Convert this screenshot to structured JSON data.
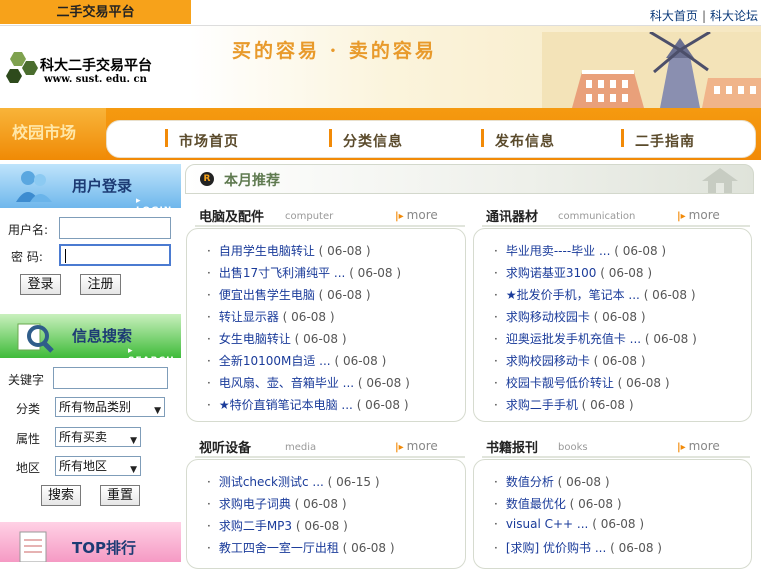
{
  "header": {
    "site_tab": "二手交易平台",
    "links": [
      "科大首页",
      "科大论坛"
    ]
  },
  "banner": {
    "logo_title": "科大二手交易平台",
    "logo_url": "www. sust. edu. cn",
    "slogan": "买的容易 · 卖的容易"
  },
  "nav": {
    "campus": "校园市场",
    "items": [
      "市场首页",
      "分类信息",
      "发布信息",
      "二手指南"
    ]
  },
  "login": {
    "title": "用户登录",
    "subtitle": "▸ LOGIN",
    "username_label": "用户名:",
    "password_label": "密  码:",
    "login_button": "登录",
    "register_button": "注册"
  },
  "search": {
    "title": "信息搜索",
    "subtitle": "▸ SEARCH",
    "keyword_label": "关键字",
    "category_label": "分类",
    "category_value": "所有物品类别",
    "type_label": "属性",
    "type_value": "所有买卖",
    "region_label": "地区",
    "region_value": "所有地区",
    "search_button": "搜索",
    "reset_button": "重置"
  },
  "top": {
    "title": "TOP排行"
  },
  "recommend": {
    "badge": "R",
    "title": "本月推荐"
  },
  "more_label": "more",
  "sections": [
    {
      "title": "电脑及配件",
      "en": "computer",
      "items": [
        {
          "text": "自用学生电脑转让",
          "date": "( 06-08 )"
        },
        {
          "text": "出售17寸飞利浦纯平 ...",
          "date": "( 06-08 )"
        },
        {
          "text": "便宜出售学生电脑",
          "date": "( 06-08 )"
        },
        {
          "text": "转让显示器",
          "date": "( 06-08 )"
        },
        {
          "text": "女生电脑转让",
          "date": "( 06-08 )"
        },
        {
          "text": "全新10100M自适 ...",
          "date": "( 06-08 )"
        },
        {
          "text": "电风扇、壶、音箱毕业 ...",
          "date": "( 06-08 )"
        },
        {
          "text": "★特价直销笔记本电脑 ...",
          "date": "( 06-08 )"
        }
      ]
    },
    {
      "title": "通讯器材",
      "en": "communication",
      "items": [
        {
          "text": "毕业甩卖----毕业 ...",
          "date": "( 06-08 )"
        },
        {
          "text": "求购诺基亚3100",
          "date": "( 06-08 )"
        },
        {
          "text": "★批发价手机，笔记本 ...",
          "date": "( 06-08 )"
        },
        {
          "text": "求购移动校园卡",
          "date": "( 06-08 )"
        },
        {
          "text": "迎奥运批发手机充值卡 ...",
          "date": "( 06-08 )"
        },
        {
          "text": "求购校园移动卡",
          "date": "( 06-08 )"
        },
        {
          "text": "校园卡靓号低价转让",
          "date": "( 06-08 )"
        },
        {
          "text": "求购二手手机",
          "date": "( 06-08 )"
        }
      ]
    },
    {
      "title": "视听设备",
      "en": "media",
      "items": [
        {
          "text": "测试check测试c ...",
          "date": "( 06-15 )"
        },
        {
          "text": "求购电子词典",
          "date": "( 06-08 )"
        },
        {
          "text": "求购二手MP3",
          "date": "( 06-08 )"
        },
        {
          "text": "教工四舍一室一厅出租",
          "date": "( 06-08 )"
        }
      ]
    },
    {
      "title": "书籍报刊",
      "en": "books",
      "items": [
        {
          "text": "数值分析",
          "date": "( 06-08 )"
        },
        {
          "text": "数值最优化",
          "date": "( 06-08 )"
        },
        {
          "text": "visual C++ ...",
          "date": "( 06-08 )"
        },
        {
          "text": "[求购] 优价购书 ...",
          "date": "( 06-08 )"
        }
      ]
    }
  ],
  "colors": {
    "accent_orange": "#f28a07",
    "link_blue": "#1a3b9a"
  }
}
